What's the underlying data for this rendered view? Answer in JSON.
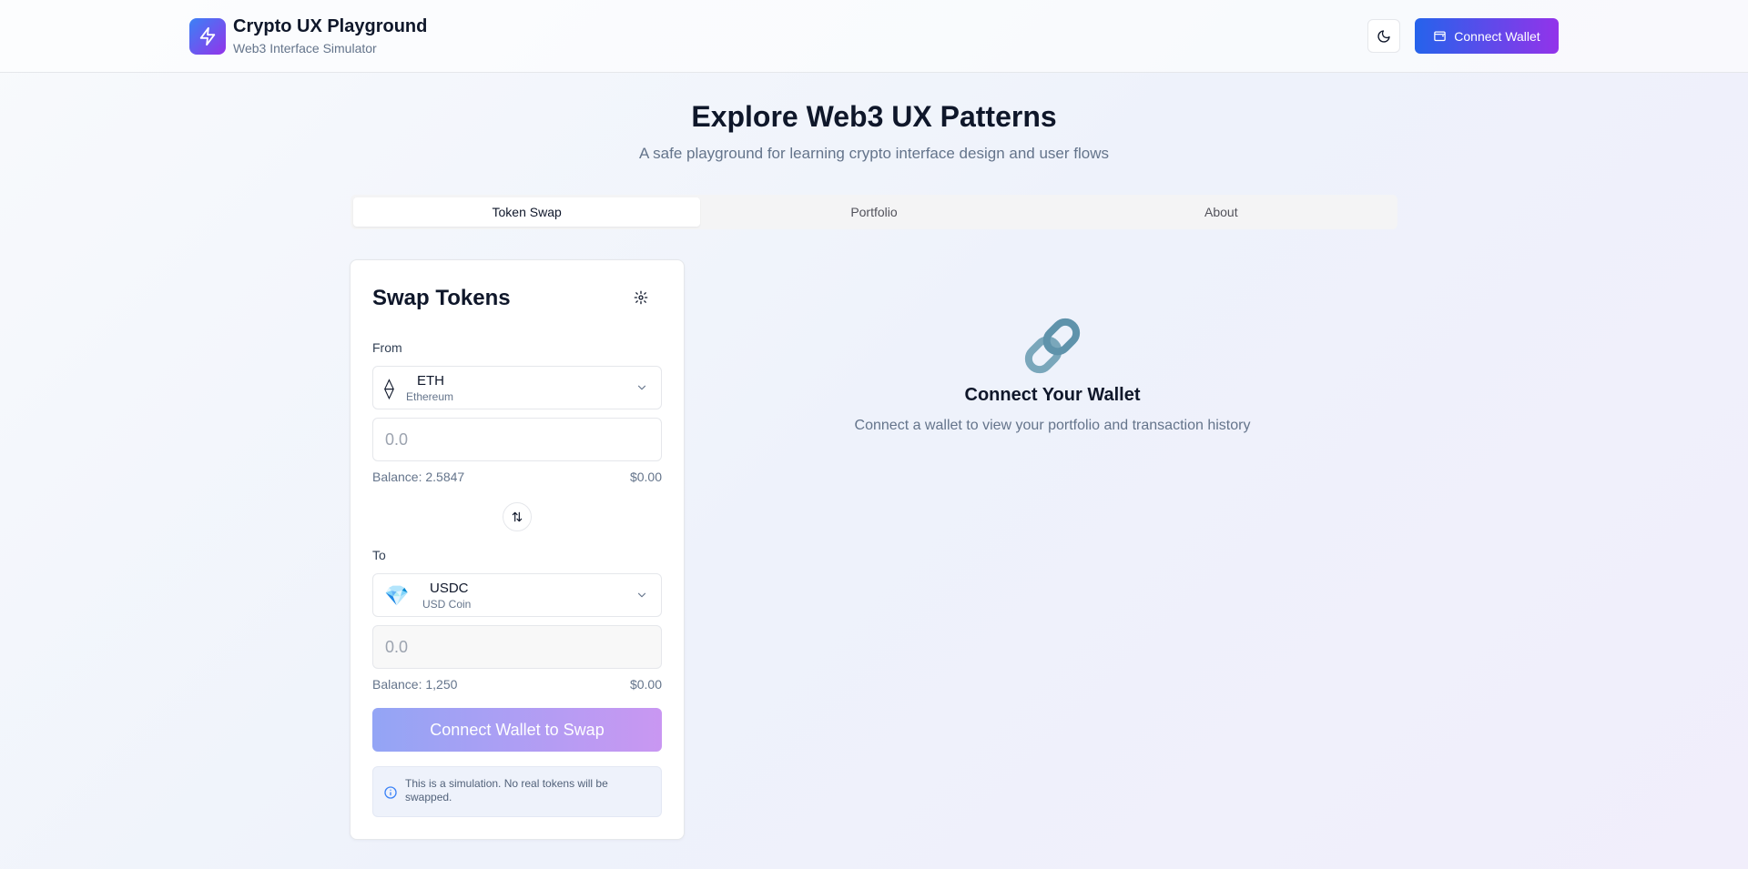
{
  "header": {
    "title": "Crypto UX Playground",
    "subtitle": "Web3 Interface Simulator",
    "connect_label": "Connect Wallet",
    "logo_icon": "lightning-bolt-icon",
    "theme_icon": "moon-icon",
    "wallet_icon": "wallet-icon"
  },
  "hero": {
    "title": "Explore Web3 UX Patterns",
    "subtitle": "A safe playground for learning crypto interface design and user flows"
  },
  "tabs": [
    {
      "label": "Token Swap",
      "active": true
    },
    {
      "label": "Portfolio",
      "active": false
    },
    {
      "label": "About",
      "active": false
    }
  ],
  "swap": {
    "title": "Swap Tokens",
    "from": {
      "label": "From",
      "symbol": "ETH",
      "name": "Ethereum",
      "icon": "⟠",
      "amount_placeholder": "0.0",
      "balance": "Balance: 2.5847",
      "usd": "$0.00"
    },
    "to": {
      "label": "To",
      "symbol": "USDC",
      "name": "USD Coin",
      "icon": "💎",
      "amount_placeholder": "0.0",
      "balance": "Balance: 1,250",
      "usd": "$0.00"
    },
    "button_label": "Connect Wallet to Swap",
    "notice": "This is a simulation. No real tokens will be swapped."
  },
  "wallet_prompt": {
    "icon": "🔗",
    "title": "Connect Your Wallet",
    "subtitle": "Connect a wallet to view your portfolio and transaction history"
  },
  "colors": {
    "accent_start": "#2563eb",
    "accent_end": "#9333ea"
  }
}
